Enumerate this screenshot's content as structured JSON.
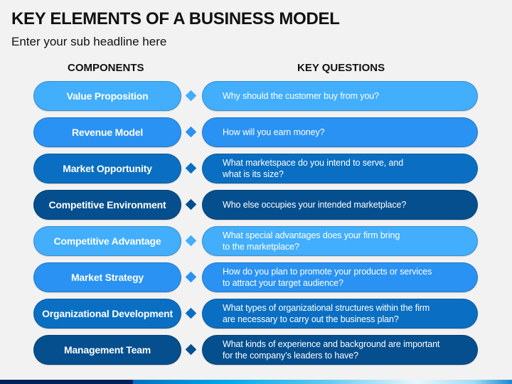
{
  "title": "KEY ELEMENTS OF A BUSINESS MODEL",
  "subtitle": "Enter your sub headline here",
  "columns": {
    "left_header": "COMPONENTS",
    "right_header": "KEY QUESTIONS"
  },
  "palette": {
    "light_blue": "#42aefc",
    "mid_blue": "#2a92f2",
    "blue": "#0a6fc2",
    "dark_blue": "#054f8e",
    "bottom_bar_dark": "#00205b"
  },
  "rows": [
    {
      "component": "Value Proposition",
      "question": "Why should the customer buy from you?",
      "color": "#42aefc"
    },
    {
      "component": "Revenue Model",
      "question": "How will you earn money?",
      "color": "#2a92f2"
    },
    {
      "component": "Market Opportunity",
      "question": "What marketspace do you intend to serve, and\nwhat is its size?",
      "color": "#0a6fc2"
    },
    {
      "component": "Competitive Environment",
      "question": "Who else occupies your intended marketplace?",
      "color": "#054f8e"
    },
    {
      "component": "Competitive Advantage",
      "question": "What special advantages does your firm bring\nto the marketplace?",
      "color": "#42aefc"
    },
    {
      "component": "Market Strategy",
      "question": "How do you plan to promote your products or services\nto attract your target audience?",
      "color": "#2a92f2"
    },
    {
      "component": "Organizational Development",
      "question": "What types of organizational structures within the firm\nare necessary to carry out the business plan?",
      "color": "#0a6fc2"
    },
    {
      "component": "Management Team",
      "question": "What kinds of experience and background are important\nfor the company’s leaders to have?",
      "color": "#054f8e"
    }
  ]
}
